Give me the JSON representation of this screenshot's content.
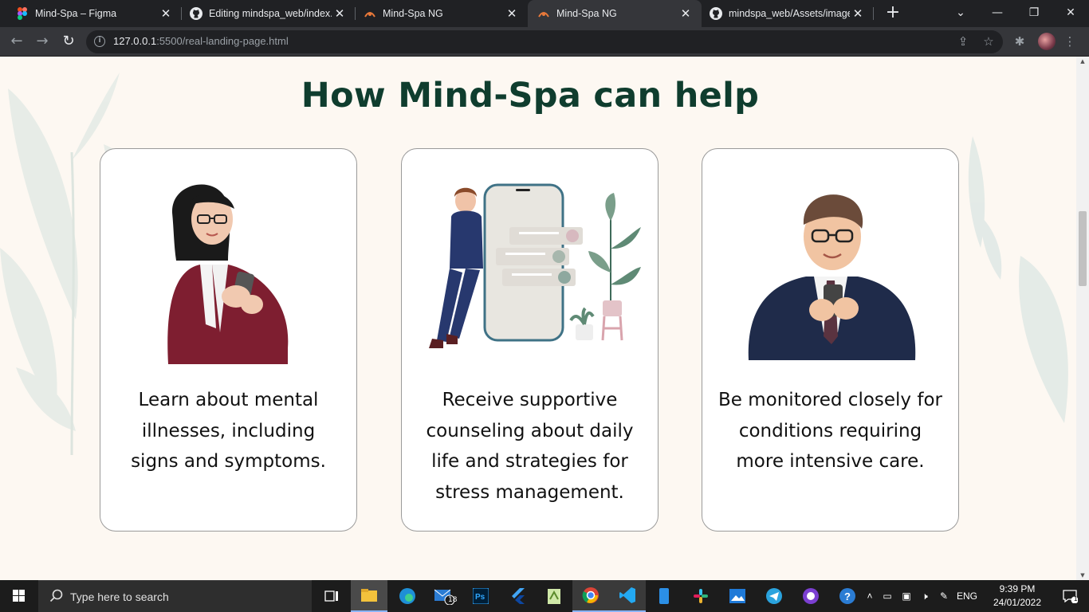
{
  "browser": {
    "tabs": [
      {
        "title": "Mind-Spa – Figma",
        "icon": "figma-icon"
      },
      {
        "title": "Editing mindspa_web/index.h",
        "icon": "github-icon"
      },
      {
        "title": "Mind-Spa NG",
        "icon": "site-icon"
      },
      {
        "title": "Mind-Spa NG",
        "icon": "site-icon",
        "active": true
      },
      {
        "title": "mindspa_web/Assets/images",
        "icon": "github-icon"
      }
    ],
    "new_tab": "+",
    "url_host": "127.0.0.1",
    "url_rest": ":5500/real-landing-page.html"
  },
  "page": {
    "section_title": "How Mind-Spa can help",
    "cards": [
      {
        "text": "Learn about mental illnesses, including signs and symptoms.",
        "illustration": "woman-with-phone"
      },
      {
        "text": "Receive supportive counseling about daily life and strategies for stress management.",
        "illustration": "woman-leaning-on-phone"
      },
      {
        "text": "Be monitored closely for conditions requiring more intensive care.",
        "illustration": "man-with-phone"
      }
    ],
    "colors": {
      "title": "#0f3d2e",
      "background": "#fdf8f2",
      "card": "#ffffff"
    }
  },
  "taskbar": {
    "search_placeholder": "Type here to search",
    "mail_badge": "18",
    "language": "ENG",
    "time": "9:39 PM",
    "date": "24/01/2022",
    "notification_count": "1"
  }
}
